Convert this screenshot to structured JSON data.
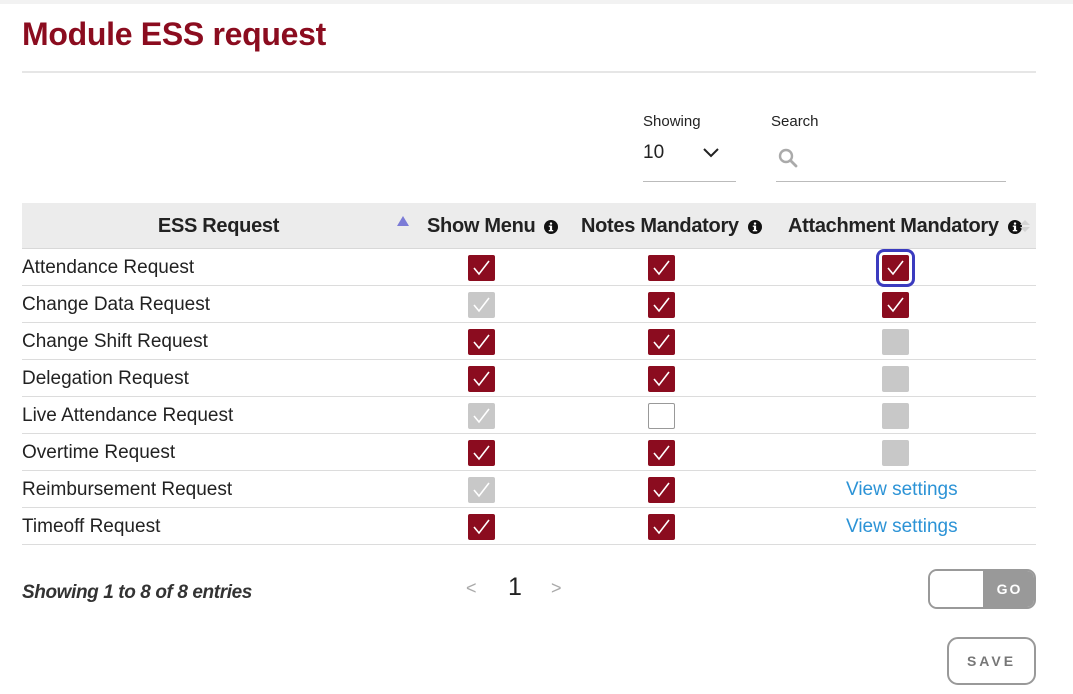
{
  "page": {
    "title": "Module ESS request"
  },
  "controls": {
    "showing_label": "Showing",
    "showing_value": "10",
    "search_label": "Search",
    "search_value": "",
    "search_placeholder": ""
  },
  "table": {
    "headers": {
      "ess_request": "ESS Request",
      "show_menu": "Show Menu",
      "notes_mandatory": "Notes Mandatory",
      "attachment_mandatory": "Attachment Mandatory"
    },
    "rows": [
      {
        "name": "Attendance Request",
        "show_menu": "on",
        "notes": "on",
        "attachment": "on",
        "attachment_link": ""
      },
      {
        "name": "Change Data Request",
        "show_menu": "dis-on",
        "notes": "on",
        "attachment": "on",
        "attachment_link": ""
      },
      {
        "name": "Change Shift Request",
        "show_menu": "on",
        "notes": "on",
        "attachment": "dis-off",
        "attachment_link": ""
      },
      {
        "name": "Delegation Request",
        "show_menu": "on",
        "notes": "on",
        "attachment": "dis-off",
        "attachment_link": ""
      },
      {
        "name": "Live Attendance Request",
        "show_menu": "dis-on",
        "notes": "off",
        "attachment": "dis-off",
        "attachment_link": ""
      },
      {
        "name": "Overtime Request",
        "show_menu": "on",
        "notes": "on",
        "attachment": "dis-off",
        "attachment_link": ""
      },
      {
        "name": "Reimbursement Request",
        "show_menu": "dis-on",
        "notes": "on",
        "attachment": "link",
        "attachment_link": "View settings"
      },
      {
        "name": "Timeoff Request",
        "show_menu": "on",
        "notes": "on",
        "attachment": "link",
        "attachment_link": "View settings"
      }
    ]
  },
  "footer": {
    "entries_text": "Showing 1 to 8 of 8 entries",
    "prev_label": "<",
    "current_page": "1",
    "next_label": ">",
    "go_label": "GO",
    "save_label": "SAVE"
  },
  "colors": {
    "brand": "#8b0c1f",
    "link": "#2c93d6",
    "disabled": "#c8c8c8",
    "focus": "#3b3bbf"
  },
  "icons": {
    "chevron": "chevron-down-icon",
    "search": "search-icon",
    "info": "info-icon",
    "sort": "sort-asc-icon",
    "check": "check-icon"
  }
}
